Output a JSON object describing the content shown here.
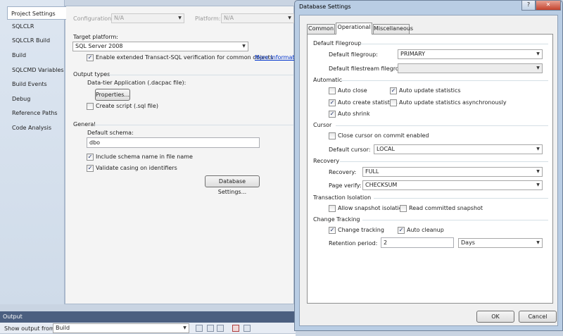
{
  "left_tabs": [
    "Project Settings",
    "SQLCLR",
    "SQLCLR Build",
    "Build",
    "SQLCMD Variables",
    "Build Events",
    "Debug",
    "Reference Paths",
    "Code Analysis"
  ],
  "main": {
    "configuration_label": "Configuration:",
    "configuration_value": "N/A",
    "platform_label": "Platform:",
    "platform_value": "N/A",
    "target_platform_label": "Target platform:",
    "target_platform_value": "SQL Server 2008",
    "enable_tsql_label": "Enable extended Transact-SQL verification for common objects",
    "more_info_link": "More Informatio",
    "output_types_label": "Output types",
    "dac_label": "Data-tier Application (.dacpac file):",
    "properties_button": "Properties...",
    "create_script_label": "Create script (.sql file)",
    "general_label": "General",
    "default_schema_label": "Default schema:",
    "default_schema_value": "dbo",
    "include_schema_label": "Include schema name in file name",
    "validate_casing_label": "Validate casing on identifiers",
    "db_settings_button": "Database Settings..."
  },
  "output": {
    "title": "Output",
    "show_from_label": "Show output from:",
    "show_from_value": "Build"
  },
  "dialog": {
    "title": "Database Settings",
    "help_btn": "?",
    "close_btn": "✕",
    "tabs": [
      "Common",
      "Operational",
      "Miscellaneous"
    ],
    "default_filegroup_section": "Default Filegroup",
    "default_filegroup_label": "Default filegroup:",
    "default_filegroup_value": "PRIMARY",
    "default_filestream_label": "Default filestream filegroup:",
    "default_filestream_value": "",
    "automatic_section": "Automatic",
    "auto_close": "Auto close",
    "auto_update_stats": "Auto update statistics",
    "auto_create_stats": "Auto create statistics",
    "auto_update_async": "Auto update statistics asynchronously",
    "auto_shrink": "Auto shrink",
    "cursor_section": "Cursor",
    "close_cursor": "Close cursor on commit enabled",
    "default_cursor_label": "Default cursor:",
    "default_cursor_value": "LOCAL",
    "recovery_section": "Recovery",
    "recovery_label": "Recovery:",
    "recovery_value": "FULL",
    "page_verify_label": "Page verify:",
    "page_verify_value": "CHECKSUM",
    "tx_isolation_section": "Transaction Isolation",
    "allow_snapshot": "Allow snapshot isolation",
    "read_committed_snapshot": "Read committed snapshot",
    "change_tracking_section": "Change Tracking",
    "change_tracking": "Change tracking",
    "auto_cleanup": "Auto cleanup",
    "retention_label": "Retention period:",
    "retention_value": "2",
    "retention_unit": "Days",
    "ok_button": "OK",
    "cancel_button": "Cancel"
  },
  "check_glyph": "✓",
  "arrow_glyph": "▼",
  "colors": {
    "accent": "#4b5f80",
    "dialog_frame": "#b9cde4",
    "link": "#0033cc"
  }
}
